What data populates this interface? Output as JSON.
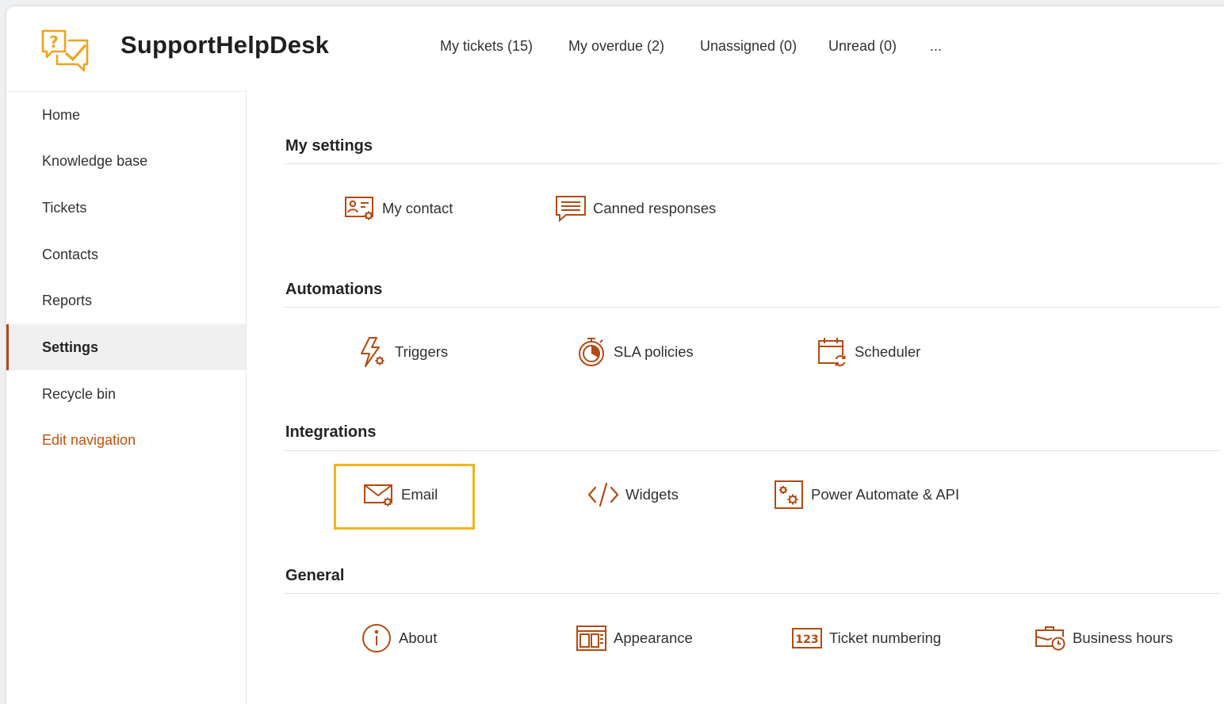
{
  "app": {
    "title": "SupportHelpDesk"
  },
  "colors": {
    "accent": "#b34a12",
    "highlight": "#f0b41c",
    "logo": "#f0a21c",
    "link": "#c4510a"
  },
  "top_nav": {
    "tabs": [
      {
        "label": "My tickets (15)"
      },
      {
        "label": "My overdue (2)"
      },
      {
        "label": "Unassigned (0)"
      },
      {
        "label": "Unread (0)"
      },
      {
        "label": "..."
      }
    ]
  },
  "sidebar": {
    "items": [
      {
        "label": "Home"
      },
      {
        "label": "Knowledge base"
      },
      {
        "label": "Tickets"
      },
      {
        "label": "Contacts"
      },
      {
        "label": "Reports"
      },
      {
        "label": "Settings",
        "active": true
      },
      {
        "label": "Recycle bin"
      },
      {
        "label": "Edit navigation"
      }
    ]
  },
  "sections": [
    {
      "title": "My settings",
      "tiles": [
        {
          "label": "My contact",
          "icon": "contact-card-gear-icon"
        },
        {
          "label": "Canned responses",
          "icon": "chat-lines-icon"
        }
      ]
    },
    {
      "title": "Automations",
      "tiles": [
        {
          "label": "Triggers",
          "icon": "lightning-gear-icon"
        },
        {
          "label": "SLA policies",
          "icon": "timer-icon"
        },
        {
          "label": "Scheduler",
          "icon": "calendar-refresh-icon"
        }
      ]
    },
    {
      "title": "Integrations",
      "tiles": [
        {
          "label": "Email",
          "icon": "envelope-gear-icon",
          "highlighted": true
        },
        {
          "label": "Widgets",
          "icon": "code-icon"
        },
        {
          "label": "Power Automate & API",
          "icon": "gears-box-icon"
        }
      ]
    },
    {
      "title": "General",
      "tiles": [
        {
          "label": "About",
          "icon": "info-circle-icon"
        },
        {
          "label": "Appearance",
          "icon": "layout-icon"
        },
        {
          "label": "Ticket numbering",
          "icon": "number-box-icon"
        },
        {
          "label": "Business hours",
          "icon": "briefcase-clock-icon"
        }
      ]
    }
  ]
}
